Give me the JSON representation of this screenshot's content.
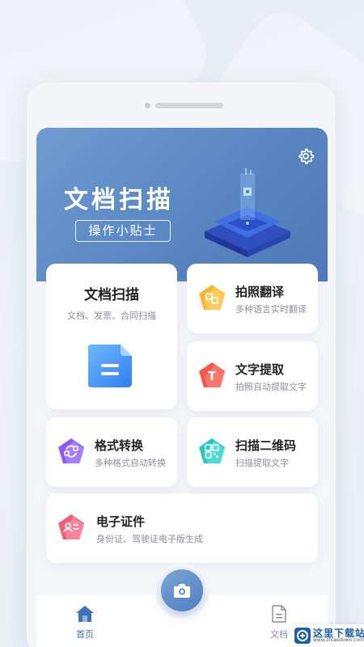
{
  "hero": {
    "title": "文档扫描",
    "tips_label": "操作小贴士"
  },
  "cards": {
    "doc_scan": {
      "title": "文档扫描",
      "subtitle": "文档、发票、合同扫描",
      "icon": "document-icon"
    },
    "photo_translate": {
      "title": "拍照翻译",
      "subtitle": "多种语言实时翻译",
      "icon": "translate-icon"
    },
    "text_extract": {
      "title": "文字提取",
      "subtitle": "拍照自动提取文字",
      "icon": "text-extract-icon"
    },
    "format_convert": {
      "title": "格式转换",
      "subtitle": "多种格式自动转换",
      "icon": "convert-icon"
    },
    "qr_scan": {
      "title": "扫描二维码",
      "subtitle": "扫描提取文字",
      "icon": "qr-code-icon"
    },
    "id_docs": {
      "title": "电子证件",
      "subtitle": "身份证、驾驶证电子版生成",
      "icon": "id-card-icon"
    }
  },
  "tabbar": {
    "home_label": "首页",
    "docs_label": "文档"
  },
  "watermark": {
    "name": "这里下载站",
    "url": "www.zhlaedown.com"
  },
  "colors": {
    "hero": "#5a86c2",
    "accent": "#3f72b8",
    "translate": "#f7b731",
    "extract": "#f2584f",
    "convert": "#8b5cf6",
    "qr": "#22c9c0",
    "idcard": "#f25d7a"
  }
}
